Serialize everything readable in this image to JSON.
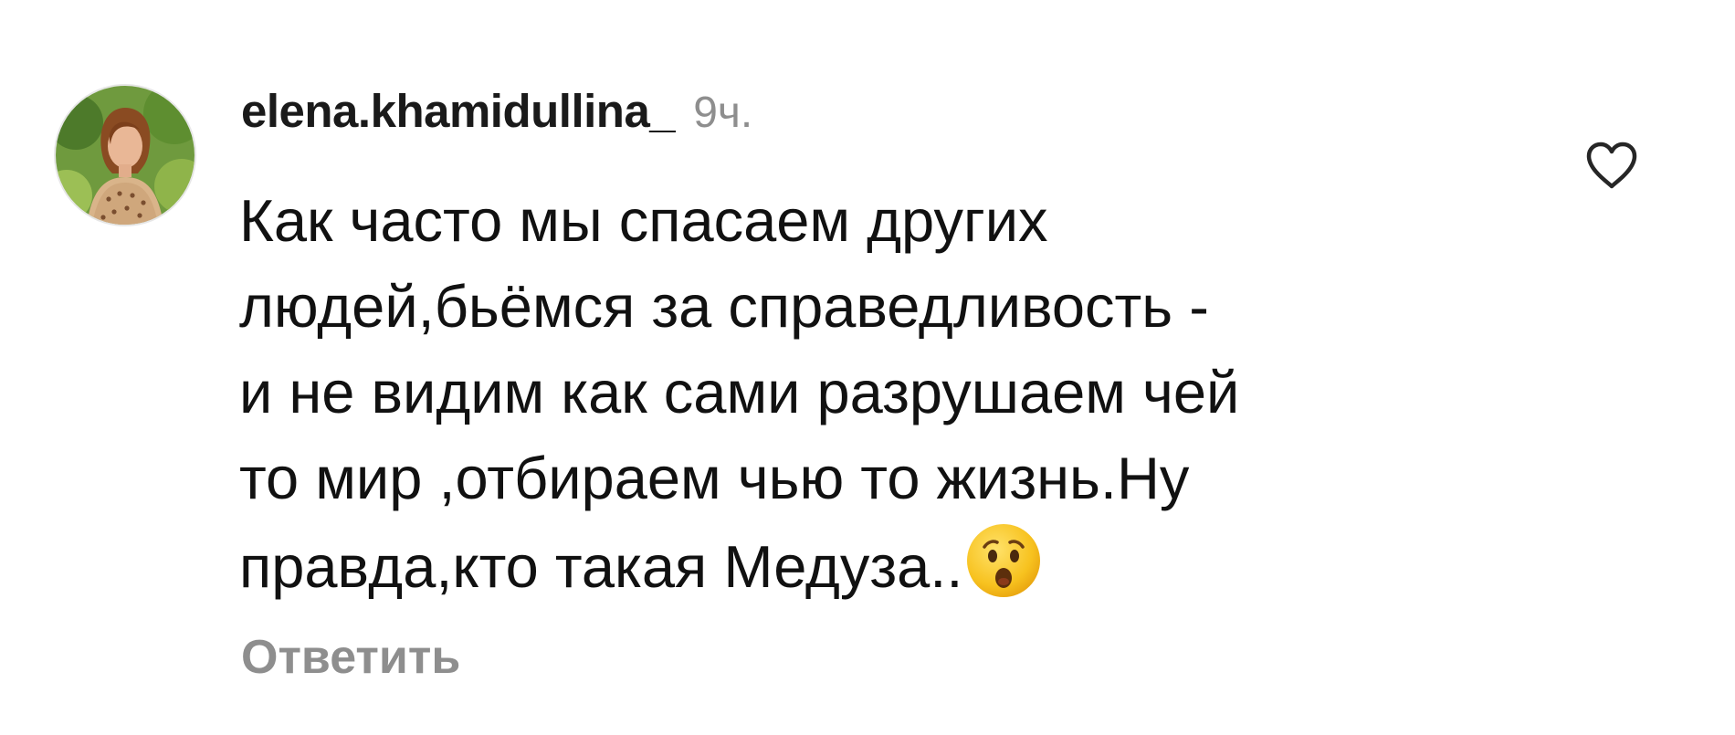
{
  "comment": {
    "username": "elena.khamidullina_",
    "time": "9ч.",
    "text_lines": [
      "Как часто мы спасаем других",
      "людей,бьёмся за справедливость -",
      "и не видим как сами разрушаем чей",
      "то мир ,отбираем чью то жизнь.Ну",
      "правда,кто такая Медуза.."
    ],
    "emoji": "hushed-face-emoji",
    "reply_label": "Ответить",
    "like_icon": "heart-outline-icon"
  },
  "colors": {
    "text": "#111111",
    "secondary": "#8e8e8e",
    "emoji": "#f7c21f"
  }
}
